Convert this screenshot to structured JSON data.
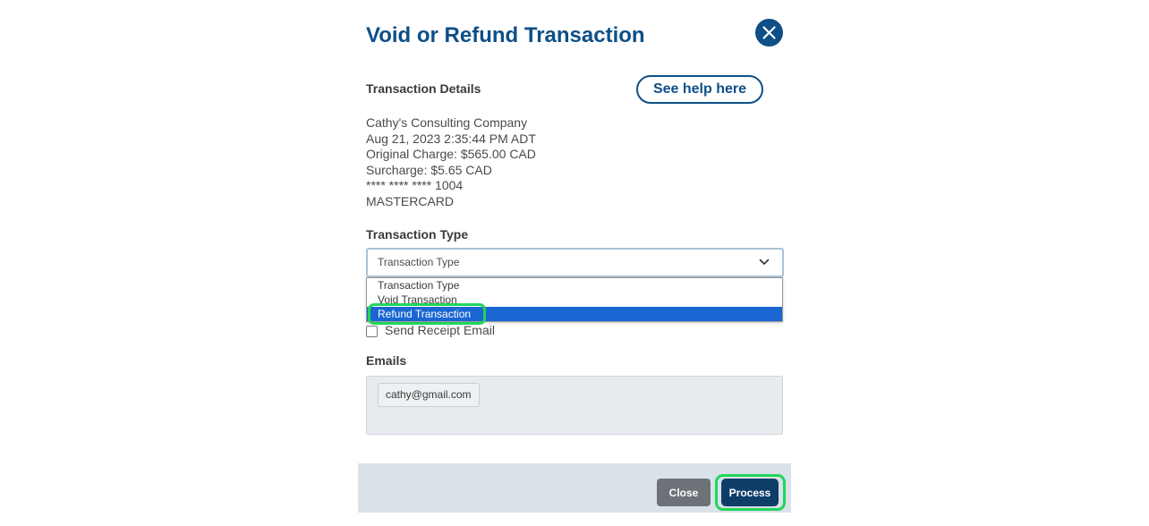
{
  "dialog": {
    "title": "Void or Refund Transaction",
    "help_button": "See help here"
  },
  "details": {
    "heading": "Transaction Details",
    "company": "Cathy's Consulting Company",
    "datetime": "Aug 21, 2023 2:35:44 PM ADT",
    "original_charge": "Original Charge: $565.00 CAD",
    "surcharge": "Surcharge: $5.65 CAD",
    "card_number": "**** **** **** 1004",
    "card_type": "MASTERCARD"
  },
  "transaction_type": {
    "heading": "Transaction Type",
    "selected_value": "Transaction Type",
    "options": [
      "Transaction Type",
      "Void Transaction",
      "Refund Transaction"
    ],
    "highlighted_option": "Refund Transaction"
  },
  "receipt": {
    "checkbox_label": "Send Receipt Email",
    "checked": false
  },
  "emails": {
    "heading": "Emails",
    "chips": [
      "cathy@gmail.com"
    ]
  },
  "footer": {
    "close_label": "Close",
    "process_label": "Process"
  },
  "colors": {
    "primary": "#0e4f87",
    "selected_option": "#1a66d2",
    "highlight_ring": "#1fd65a",
    "close_button": "#6c7278",
    "process_button": "#0e3e68",
    "footer_bg": "#d9e1e9"
  },
  "icons": {
    "close": "close-icon",
    "dropdown": "chevron-down-icon"
  }
}
